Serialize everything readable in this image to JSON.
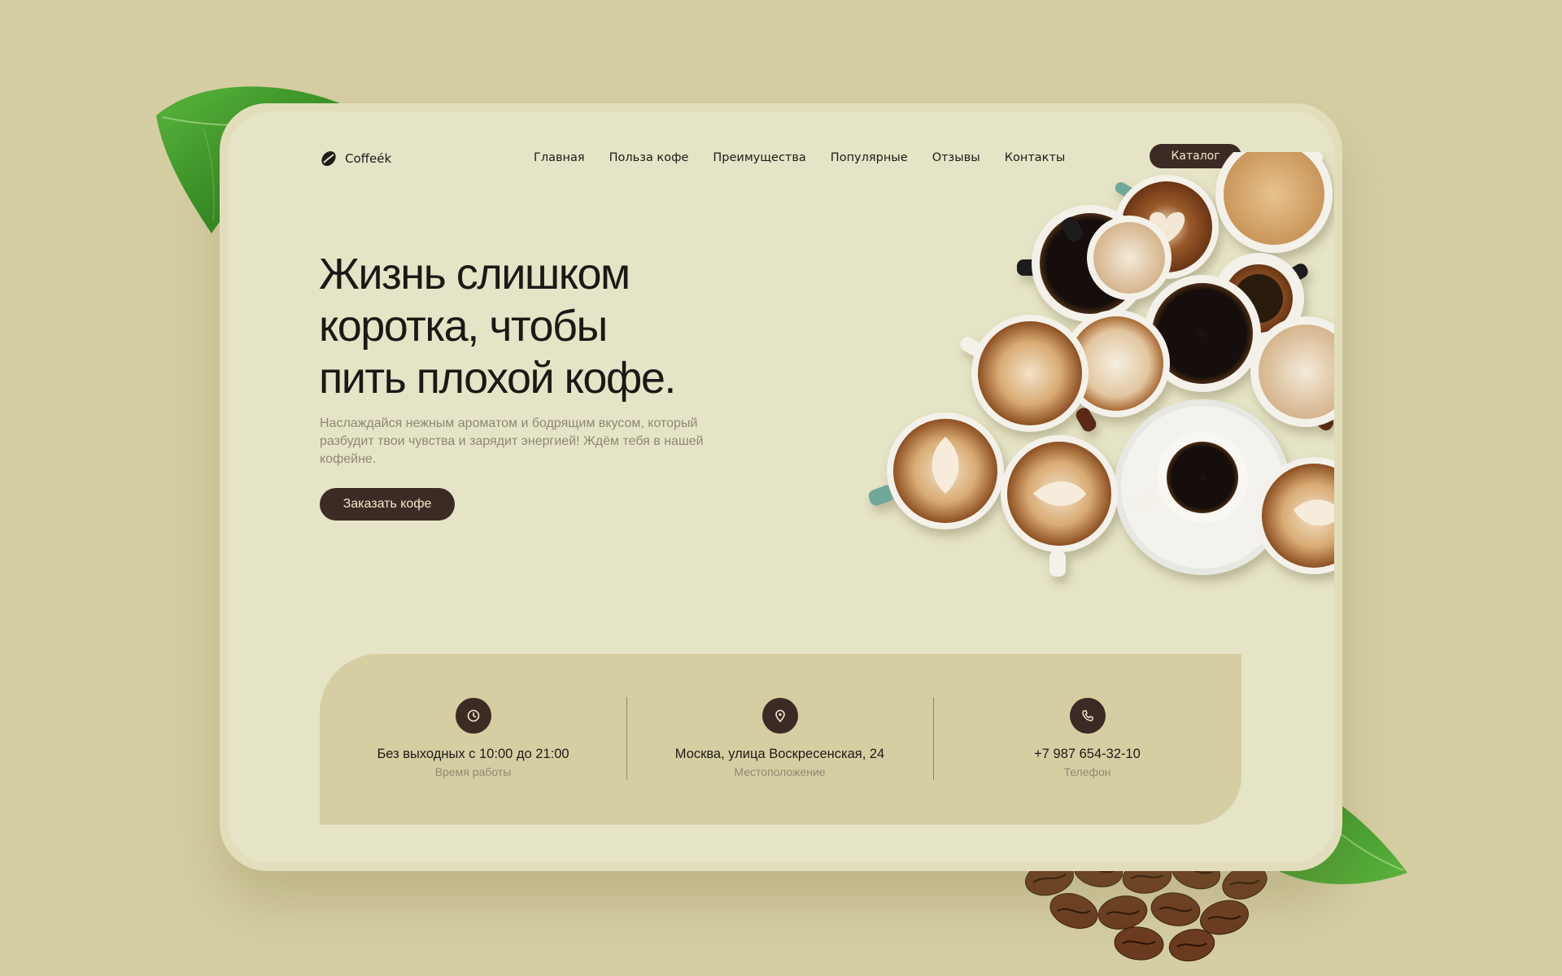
{
  "brand": {
    "name": "Coffeék"
  },
  "nav": {
    "items": [
      {
        "label": "Главная"
      },
      {
        "label": "Польза кофе"
      },
      {
        "label": "Преимущества"
      },
      {
        "label": "Популярные"
      },
      {
        "label": "Отзывы"
      },
      {
        "label": "Контакты"
      }
    ],
    "catalog_label": "Каталог"
  },
  "hero": {
    "title_lines": [
      "Жизнь слишком",
      "коротка, чтобы",
      "пить плохой кофе."
    ],
    "description": "Наслаждайся нежным ароматом и бодрящим вкусом, который разбудит твои чувства и зарядит энергией! Ждём тебя в нашей кофейне.",
    "cta_label": "Заказать кофе"
  },
  "info": {
    "items": [
      {
        "icon": "clock-icon",
        "value": "Без выходных с 10:00 до 21:00",
        "label": "Время работы"
      },
      {
        "icon": "location-pin-icon",
        "value": "Москва, улица Воскресенская, 24",
        "label": "Местоположение"
      },
      {
        "icon": "phone-icon",
        "value": "+7 987 654-32-10",
        "label": "Телефон"
      }
    ]
  },
  "colors": {
    "background": "#d6cea3",
    "card": "#e6e4c6",
    "accent_dark": "#3c2b25",
    "button_text": "#f1e8cc",
    "muted_text": "#8d8873",
    "leaf_green": "#3f9a2c"
  }
}
